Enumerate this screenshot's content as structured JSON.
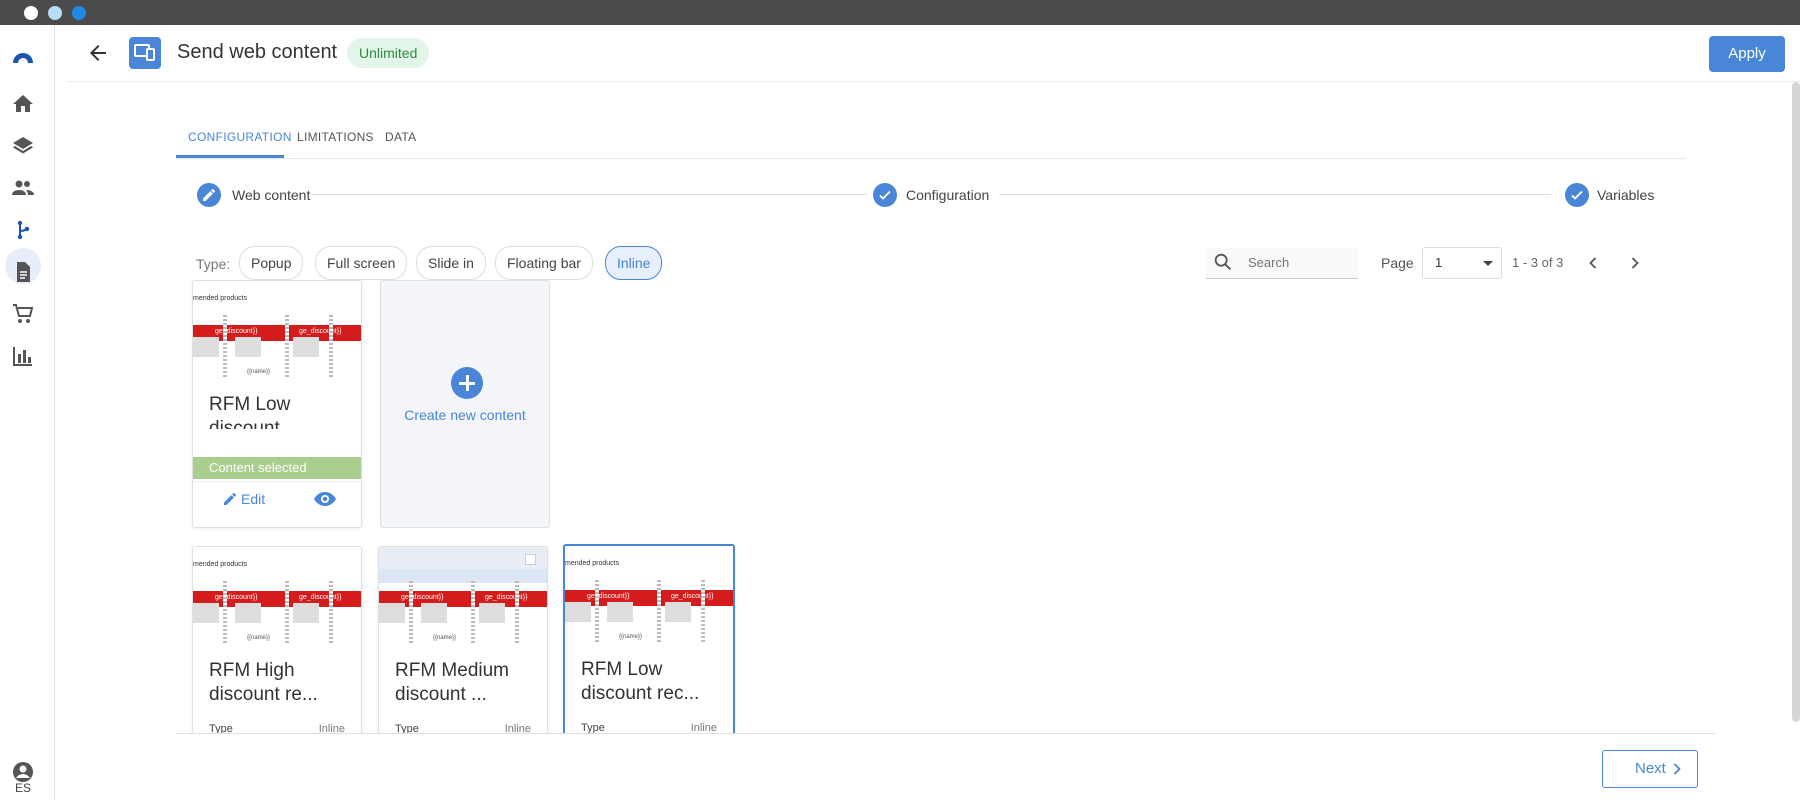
{
  "header": {
    "title": "Send web content",
    "badge": "Unlimited",
    "apply_label": "Apply"
  },
  "sidebar": {
    "items": [
      {
        "icon": "logo-icon"
      },
      {
        "icon": "home-icon"
      },
      {
        "icon": "layers-icon"
      },
      {
        "icon": "people-icon"
      },
      {
        "icon": "flow-icon",
        "active": true
      },
      {
        "icon": "document-icon"
      },
      {
        "icon": "cart-icon"
      },
      {
        "icon": "bar-chart-icon"
      }
    ],
    "language": "ES"
  },
  "tabs": [
    {
      "label": "CONFIGURATION",
      "active": true
    },
    {
      "label": "LIMITATIONS"
    },
    {
      "label": "DATA"
    }
  ],
  "steps": [
    {
      "label": "Web content",
      "state": "editing"
    },
    {
      "label": "Configuration",
      "state": "done"
    },
    {
      "label": "Variables",
      "state": "done"
    }
  ],
  "filters": {
    "type_label": "Type:",
    "types": [
      "Popup",
      "Full screen",
      "Slide in",
      "Floating bar",
      "Inline"
    ],
    "active_type": "Inline"
  },
  "search": {
    "placeholder": "Search",
    "value": ""
  },
  "pagination": {
    "page_label": "Page",
    "current_page": "1",
    "range": "1 - 3 of 3"
  },
  "selected_card": {
    "title": "RFM Low discount",
    "status": "Content selected",
    "edit_label": "Edit"
  },
  "create_card": {
    "label": "Create new content"
  },
  "thumbnail_text": {
    "heading": "mended products",
    "band": "ge_discount}}",
    "name": "{{name}}"
  },
  "cards": [
    {
      "title_line1": "RFM High",
      "title_line2": "discount re...",
      "type_label": "Type",
      "type_value": "Inline"
    },
    {
      "title_line1": "RFM Medium",
      "title_line2": "discount ...",
      "type_label": "Type",
      "type_value": "Inline"
    },
    {
      "title_line1": "RFM Low",
      "title_line2": "discount rec...",
      "type_label": "Type",
      "type_value": "Inline"
    }
  ],
  "footer": {
    "next_label": "Next"
  },
  "colors": {
    "accent": "#4a86d8",
    "badge_bg": "#e3f5e8",
    "badge_text": "#2e8a3e",
    "selected_bar": "#a8cf8e",
    "thumb_band": "#d41c1c"
  }
}
